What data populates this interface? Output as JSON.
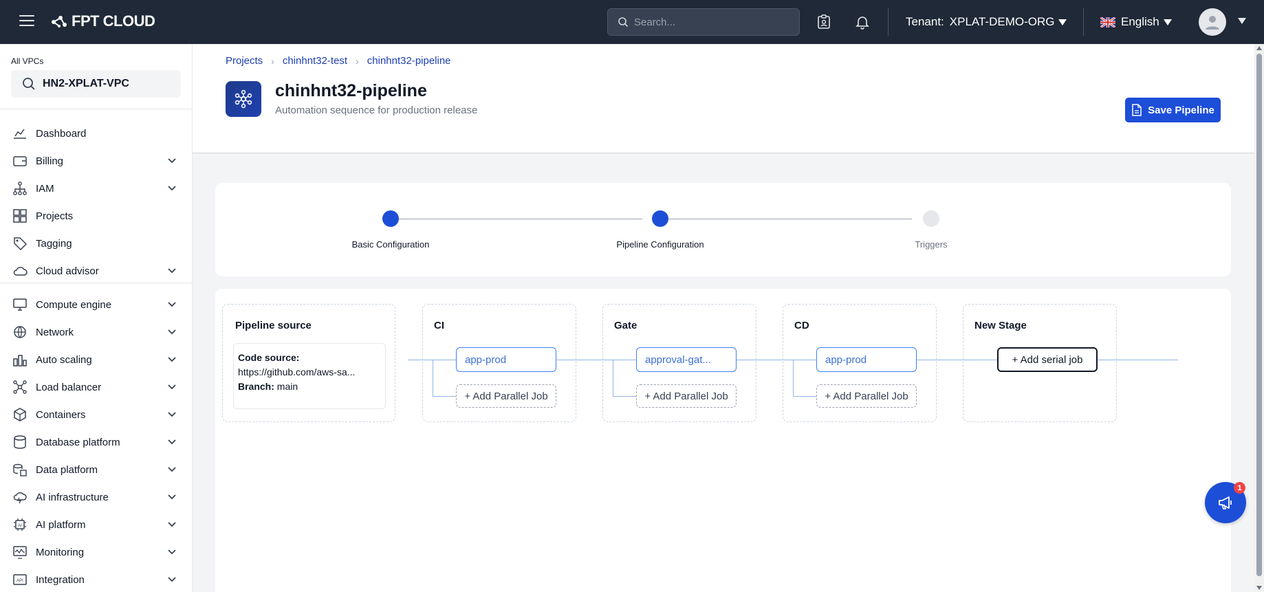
{
  "topbar": {
    "brand": "FPT CLOUD",
    "search_placeholder": "Search...",
    "tenant_label": "Tenant:",
    "tenant_value": "XPLAT-DEMO-ORG",
    "language": "English"
  },
  "sidebar": {
    "vpc_label": "All VPCs",
    "vpc_value": "HN2-XPLAT-VPC",
    "items": [
      {
        "label": "Dashboard",
        "icon": "dashboard-icon",
        "expandable": false
      },
      {
        "label": "Billing",
        "icon": "wallet-icon",
        "expandable": true
      },
      {
        "label": "IAM",
        "icon": "hierarchy-icon",
        "expandable": true
      },
      {
        "label": "Projects",
        "icon": "projects-icon",
        "expandable": false
      },
      {
        "label": "Tagging",
        "icon": "tag-icon",
        "expandable": false
      },
      {
        "label": "Cloud advisor",
        "icon": "cloud-icon",
        "expandable": true
      },
      {
        "label": "Compute engine",
        "icon": "monitor-icon",
        "expandable": true
      },
      {
        "label": "Network",
        "icon": "globe-icon",
        "expandable": true
      },
      {
        "label": "Auto scaling",
        "icon": "bar-chart-icon",
        "expandable": true
      },
      {
        "label": "Load balancer",
        "icon": "network-nodes-icon",
        "expandable": true
      },
      {
        "label": "Containers",
        "icon": "cube-icon",
        "expandable": true
      },
      {
        "label": "Database platform",
        "icon": "database-icon",
        "expandable": true
      },
      {
        "label": "Data platform",
        "icon": "data-stack-icon",
        "expandable": true
      },
      {
        "label": "AI infrastructure",
        "icon": "cloud-ai-icon",
        "expandable": true
      },
      {
        "label": "AI platform",
        "icon": "ai-chip-icon",
        "expandable": true
      },
      {
        "label": "Monitoring",
        "icon": "monitoring-icon",
        "expandable": true
      },
      {
        "label": "Integration",
        "icon": "api-icon",
        "expandable": true
      }
    ]
  },
  "breadcrumb": [
    "Projects",
    "chinhnt32-test",
    "chinhnt32-pipeline"
  ],
  "page": {
    "title": "chinhnt32-pipeline",
    "subtitle": "Automation sequence for production release",
    "save_label": "Save Pipeline"
  },
  "stepper": {
    "steps": [
      {
        "label": "Basic Configuration",
        "state": "done"
      },
      {
        "label": "Pipeline Configuration",
        "state": "active"
      },
      {
        "label": "Triggers",
        "state": "pending"
      }
    ],
    "colors": {
      "active": "#1d4ed8",
      "pending": "#e5e7eb"
    }
  },
  "pipeline": {
    "source": {
      "title": "Pipeline source",
      "code_source_label": "Code source:",
      "code_source_value": "https://github.com/aws-sa...",
      "branch_label": "Branch:",
      "branch_value": "main"
    },
    "stages": [
      {
        "title": "CI",
        "job": "app-prod",
        "parallel_label": "+ Add Parallel Job"
      },
      {
        "title": "Gate",
        "job": "approval-gat...",
        "parallel_label": "+ Add Parallel Job"
      },
      {
        "title": "CD",
        "job": "app-prod",
        "parallel_label": "+ Add Parallel Job"
      }
    ],
    "new_stage": {
      "title": "New Stage",
      "serial_label": "+ Add serial job"
    }
  },
  "notification_badge": "1"
}
